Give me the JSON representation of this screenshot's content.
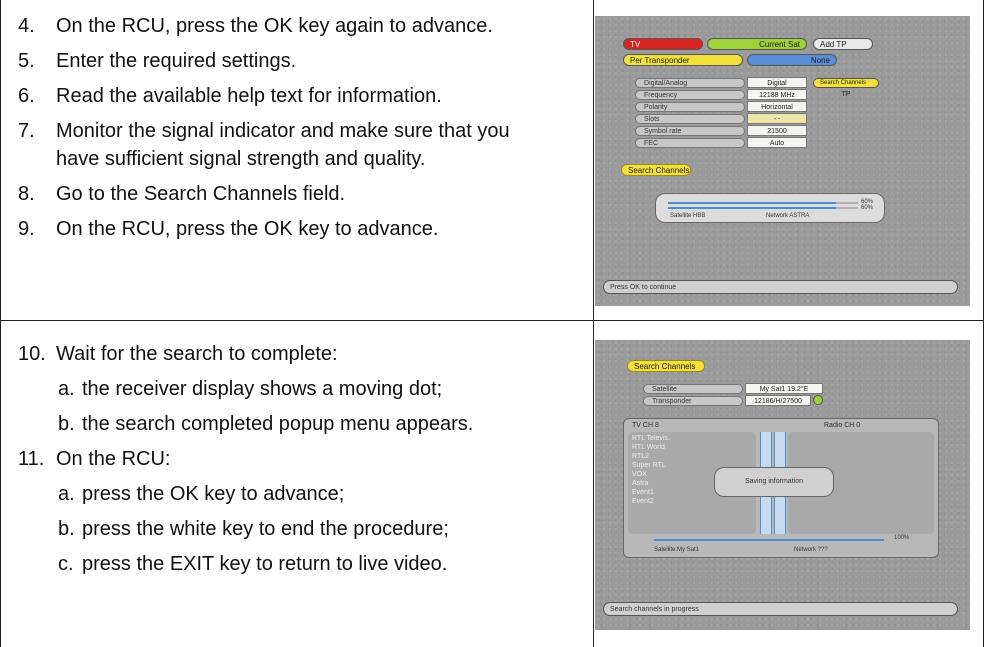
{
  "section1": {
    "steps": [
      {
        "num": "4.",
        "text": "On the RCU, press the OK key again to advance."
      },
      {
        "num": "5.",
        "text": "Enter the required settings."
      },
      {
        "num": "6.",
        "text": "Read the available help text for information."
      },
      {
        "num": "7.",
        "text": "Monitor the signal indicator and make sure that you have sufficient signal strength and quality."
      },
      {
        "num": "8.",
        "text": "Go to the Search Channels field."
      },
      {
        "num": "9.",
        "text": "On the RCU, press the OK key to advance."
      }
    ]
  },
  "section2": {
    "step10": {
      "num": "10.",
      "text": "Wait for the search to complete:"
    },
    "step10_subs": [
      {
        "num": "a.",
        "text": "the receiver display shows a moving dot;"
      },
      {
        "num": "b.",
        "text": "the search completed popup menu appears."
      }
    ],
    "step11": {
      "num": "11.",
      "text": "On the RCU:"
    },
    "step11_subs": [
      {
        "num": "a.",
        "text": "press the OK key to advance;"
      },
      {
        "num": "b.",
        "text": "press the white key to end the procedure;"
      },
      {
        "num": "c.",
        "text": "press the EXIT key to return to live video."
      }
    ]
  },
  "screen1": {
    "top_red": "TV",
    "top_green": "Current Sat",
    "top_right": "Add TP",
    "second_yellow": "Per Transponder",
    "second_blue": "None",
    "rows": [
      {
        "label": "Digital/Analog",
        "value": "Digital"
      },
      {
        "label": "Frequency",
        "value": "12188 MHz"
      },
      {
        "label": "Polarity",
        "value": "Horizontal"
      },
      {
        "label": "Slots",
        "value": "- -"
      },
      {
        "label": "Symbol rate",
        "value": "21500"
      },
      {
        "label": "FEC",
        "value": "Auto"
      }
    ],
    "search_mode_label": "Search Channels",
    "search_mode_value": "TP",
    "search_button": "Search Channels",
    "pct1": "60%",
    "pct2": "60%",
    "signal_left": "Satellite HBB",
    "signal_right": "Network ASTRA",
    "status": "Press OK to continue",
    "colors": {
      "red": "#d8241f",
      "green": "#9fd23a",
      "yellow": "#f2e13c",
      "blue": "#5b8ed8"
    }
  },
  "screen2": {
    "search_button": "Search Channels",
    "rows": [
      {
        "label": "Satellite",
        "value": "My Sat1 19.2°E"
      },
      {
        "label": "Transponder",
        "value": "12186/H/27500"
      }
    ],
    "tv_header": "TV CH 8",
    "radio_header": "Radio CH 0",
    "tv_channels": [
      "RTL Televis.",
      "RTL World",
      "RTL2",
      "Super RTL",
      "VOX",
      "Astra",
      "Event1",
      "Event2"
    ],
    "popup": "Saving information",
    "pct": "100%",
    "footer_left": "Satellite My Sat1",
    "footer_right": "Network ???",
    "status": "Search channels in progress"
  }
}
